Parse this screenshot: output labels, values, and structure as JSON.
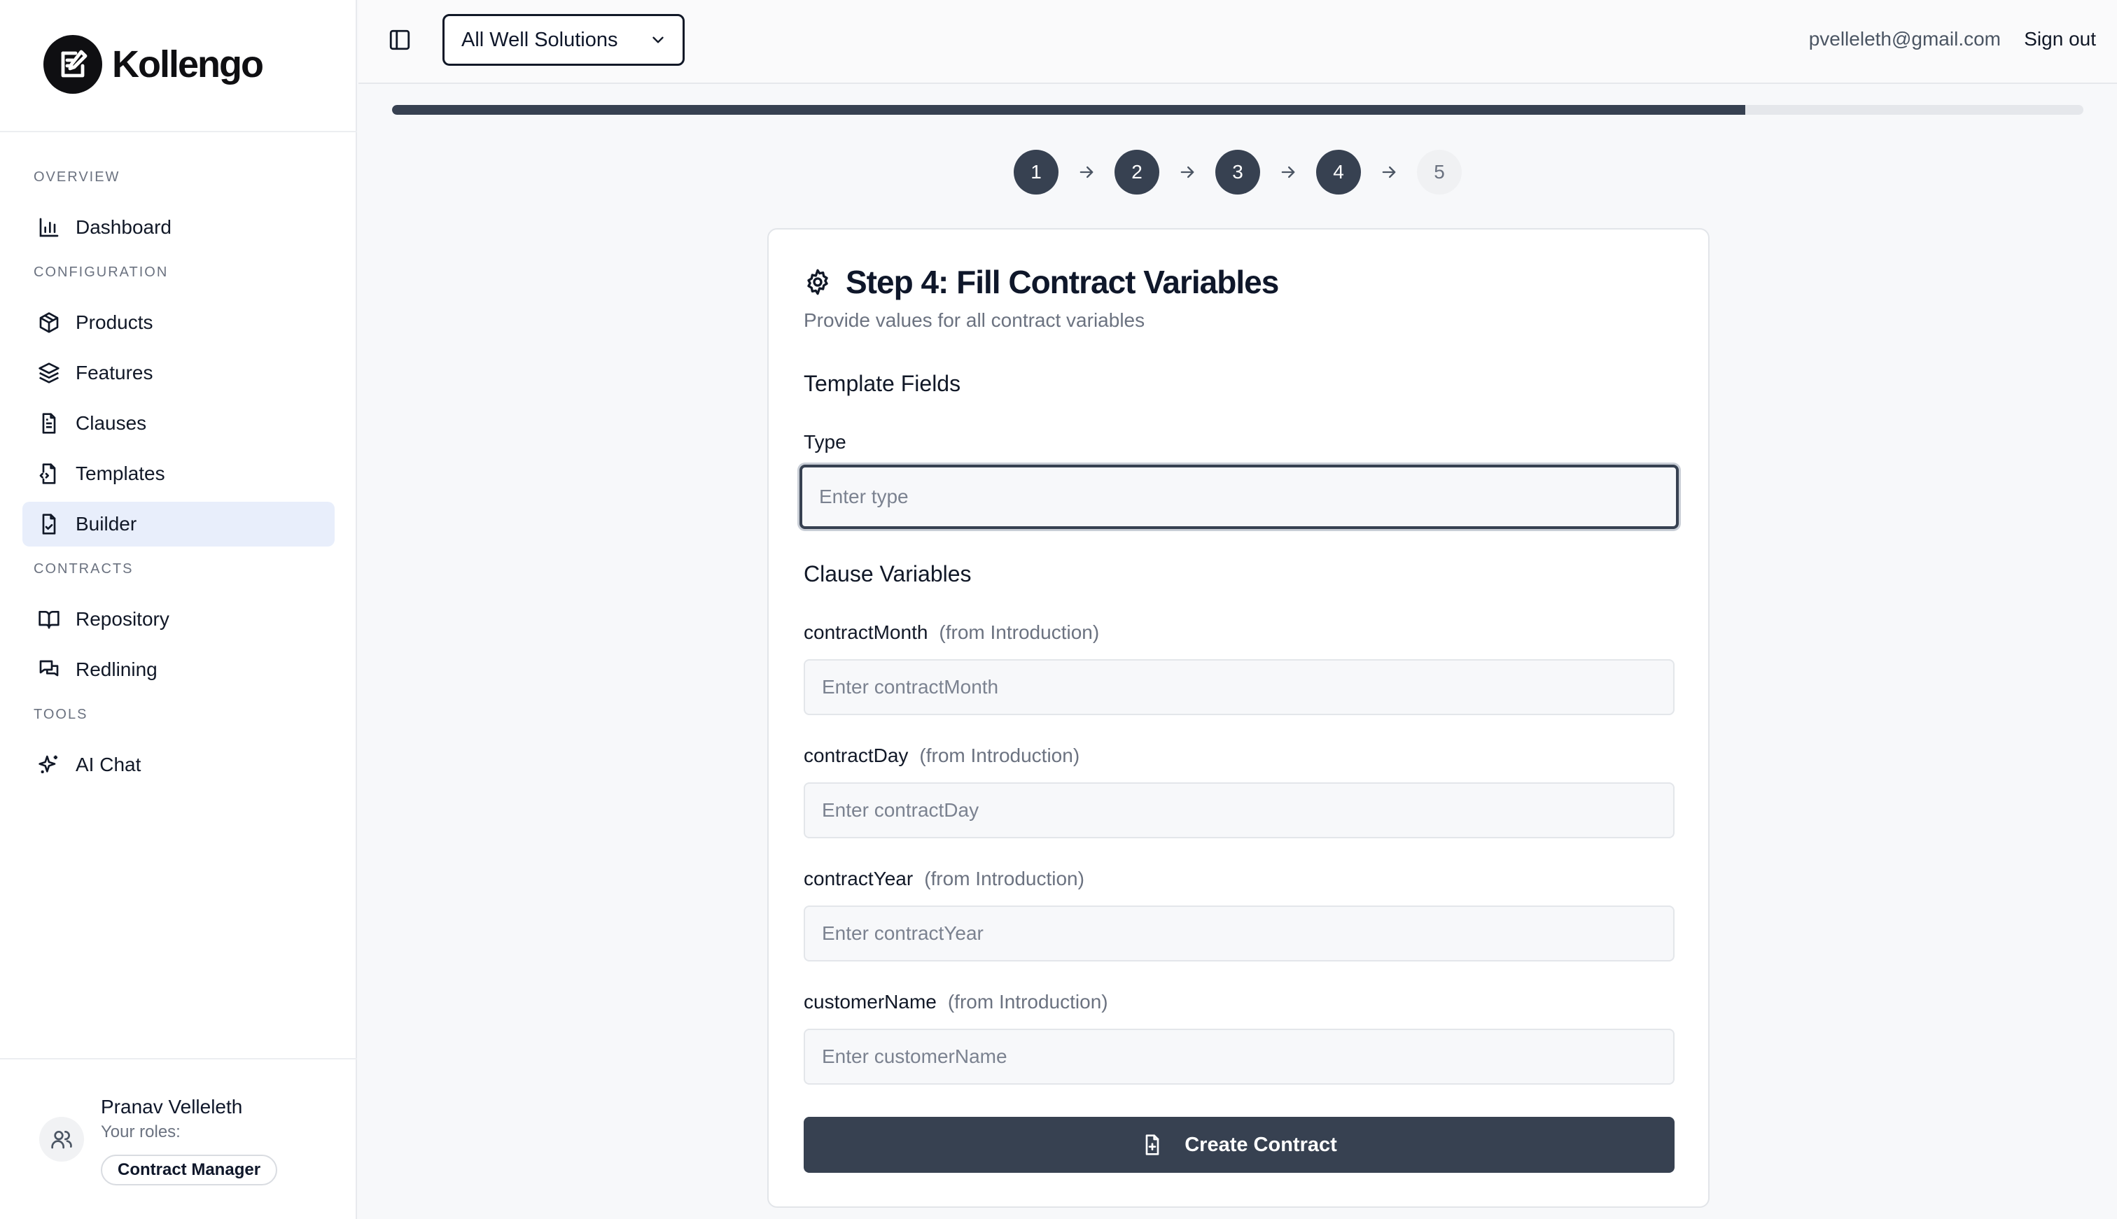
{
  "app": {
    "name": "Kollengo"
  },
  "sidebar": {
    "sections": {
      "overview": "OVERVIEW",
      "configuration": "CONFIGURATION",
      "contracts": "CONTRACTS",
      "tools": "TOOLS"
    },
    "items": {
      "dashboard": "Dashboard",
      "products": "Products",
      "features": "Features",
      "clauses": "Clauses",
      "templates": "Templates",
      "builder": "Builder",
      "repository": "Repository",
      "redlining": "Redlining",
      "ai_chat": "AI Chat"
    },
    "active_item": "Builder",
    "user": {
      "name": "Pranav Velleleth",
      "roles_label": "Your roles:",
      "role": "Contract Manager"
    }
  },
  "header": {
    "workspace": "All Well Solutions",
    "email": "pvelleleth@gmail.com",
    "sign_out": "Sign out"
  },
  "progress": {
    "fraction": 0.8
  },
  "steps": [
    {
      "label": "1",
      "state": "done"
    },
    {
      "label": "2",
      "state": "done"
    },
    {
      "label": "3",
      "state": "done"
    },
    {
      "label": "4",
      "state": "done"
    },
    {
      "label": "5",
      "state": "todo"
    }
  ],
  "card": {
    "title": "Step 4: Fill Contract Variables",
    "subtitle": "Provide values for all contract variables",
    "template_section": "Template Fields",
    "type_label": "Type",
    "type_placeholder": "Enter type",
    "clause_section": "Clause Variables",
    "variables": [
      {
        "name": "contractMonth",
        "source": "(from Introduction)",
        "placeholder": "Enter contractMonth"
      },
      {
        "name": "contractDay",
        "source": "(from Introduction)",
        "placeholder": "Enter contractDay"
      },
      {
        "name": "contractYear",
        "source": "(from Introduction)",
        "placeholder": "Enter contractYear"
      },
      {
        "name": "customerName",
        "source": "(from Introduction)",
        "placeholder": "Enter customerName"
      }
    ],
    "create_button": "Create Contract"
  },
  "colors": {
    "primary": "#374151",
    "active_nav": "#e8eefb"
  }
}
